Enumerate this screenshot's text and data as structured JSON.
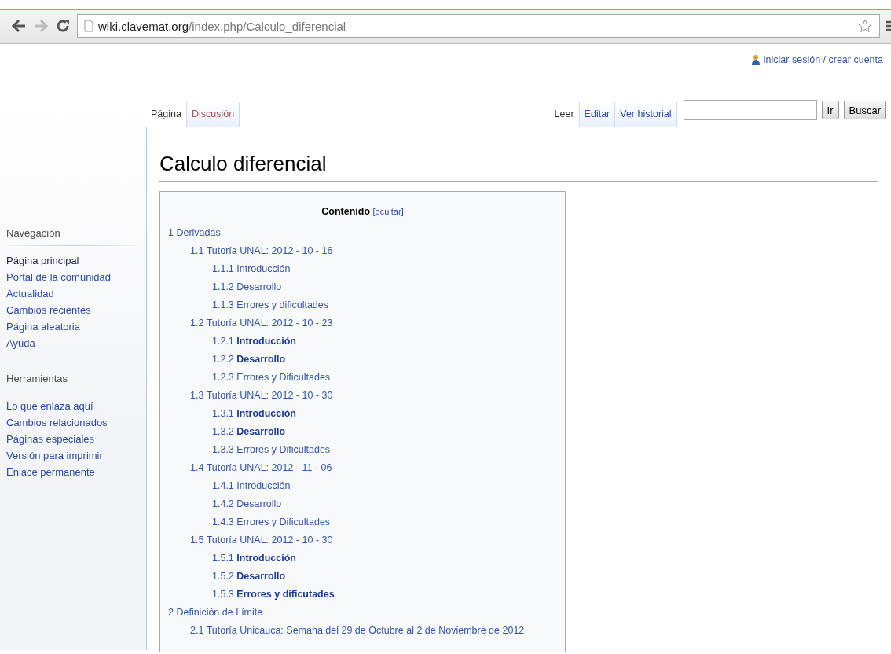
{
  "browser": {
    "url_host": "wiki.clavemat.org",
    "url_path": "/index.php/Calculo_diferencial"
  },
  "personal": {
    "label": "Iniciar sesión / crear cuenta"
  },
  "left_tabs": [
    {
      "label": "Página",
      "selected": true,
      "missing": false
    },
    {
      "label": "Discusión",
      "selected": false,
      "missing": true
    }
  ],
  "right_tabs": [
    {
      "label": "Leer",
      "selected": true
    },
    {
      "label": "Editar",
      "selected": false
    },
    {
      "label": "Ver historial",
      "selected": false
    }
  ],
  "search": {
    "go_button": "Ir",
    "search_button": "Buscar"
  },
  "sidebar": [
    {
      "heading": "Navegación",
      "items": [
        {
          "label": "Página principal",
          "visited": true
        },
        {
          "label": "Portal de la comunidad",
          "visited": false
        },
        {
          "label": "Actualidad",
          "visited": false
        },
        {
          "label": "Cambios recientes",
          "visited": false
        },
        {
          "label": "Página aleatoria",
          "visited": false
        },
        {
          "label": "Ayuda",
          "visited": false
        }
      ]
    },
    {
      "heading": "Herramientas",
      "items": [
        {
          "label": "Lo que enlaza aquí",
          "visited": false
        },
        {
          "label": "Cambios relacionados",
          "visited": false
        },
        {
          "label": "Páginas especiales",
          "visited": false
        },
        {
          "label": "Versión para imprimir",
          "visited": false
        },
        {
          "label": "Enlace permanente",
          "visited": false
        }
      ]
    }
  ],
  "page_title": "Calculo diferencial",
  "toc": {
    "title": "Contenido",
    "toggle": "[ocultar]",
    "items": [
      {
        "number": "1",
        "title": "Derivadas",
        "bold": false,
        "children": [
          {
            "number": "1.1",
            "title": "Tutoría UNAL: 2012 - 10 - 16",
            "bold": false,
            "children": [
              {
                "number": "1.1.1",
                "title": "Introducción",
                "bold": false
              },
              {
                "number": "1.1.2",
                "title": "Desarrollo",
                "bold": false
              },
              {
                "number": "1.1.3",
                "title": "Errores y dificultades",
                "bold": false
              }
            ]
          },
          {
            "number": "1.2",
            "title": "Tutoría UNAL: 2012 - 10 - 23",
            "bold": false,
            "children": [
              {
                "number": "1.2.1",
                "title": "Introducción",
                "bold": true
              },
              {
                "number": "1.2.2",
                "title": "Desarrollo",
                "bold": true
              },
              {
                "number": "1.2.3",
                "title": "Errores y Dificultades",
                "bold": false
              }
            ]
          },
          {
            "number": "1.3",
            "title": "Tutoría UNAL: 2012 - 10 - 30",
            "bold": false,
            "children": [
              {
                "number": "1.3.1",
                "title": "Introducción",
                "bold": true
              },
              {
                "number": "1.3.2",
                "title": "Desarrollo",
                "bold": true
              },
              {
                "number": "1.3.3",
                "title": "Errores y Dificultades",
                "bold": false
              }
            ]
          },
          {
            "number": "1.4",
            "title": "Tutoría UNAL: 2012 - 11 - 06",
            "bold": false,
            "children": [
              {
                "number": "1.4.1",
                "title": "Introducción",
                "bold": false
              },
              {
                "number": "1.4.2",
                "title": "Desarrollo",
                "bold": false
              },
              {
                "number": "1.4.3",
                "title": "Errores y Dificultades",
                "bold": false
              }
            ]
          },
          {
            "number": "1.5",
            "title": "Tutoría UNAL: 2012 - 10 - 30",
            "bold": false,
            "children": [
              {
                "number": "1.5.1",
                "title": "Introducción",
                "bold": true
              },
              {
                "number": "1.5.2",
                "title": "Desarrollo",
                "bold": true
              },
              {
                "number": "1.5.3",
                "title": "Errores y dificutades",
                "bold": true
              }
            ]
          }
        ]
      },
      {
        "number": "2",
        "title": "Definición de Límite",
        "bold": false,
        "children": [
          {
            "number": "2.1",
            "title": "Tutoría Unicauca: Semana del 29 de Octubre al 2 de Noviembre de 2012",
            "bold": false
          }
        ]
      }
    ]
  }
}
